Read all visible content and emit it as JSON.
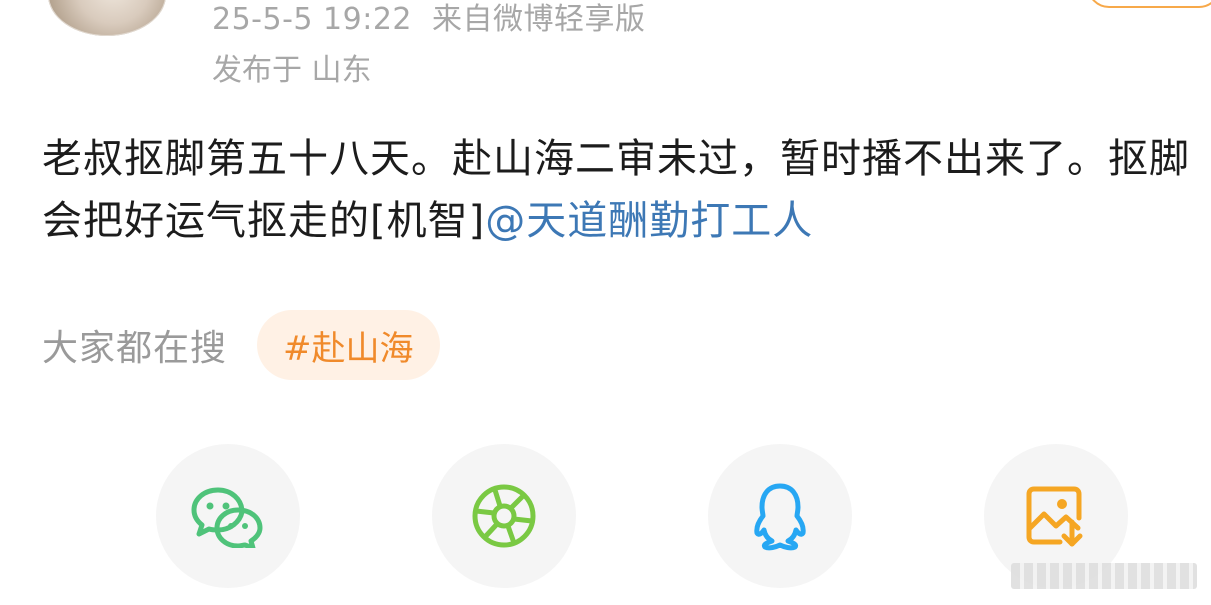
{
  "post": {
    "timestamp": "25-5-5 19:22",
    "source": "来自微博轻享版",
    "location": "发布于 山东",
    "text": "老叔抠脚第五十八天。赴山海二审未过，暂时播不出来了。抠脚会把好运气抠走的[机智]",
    "mention": "@天道酬勤打工人"
  },
  "search": {
    "label": "大家都在搜",
    "topic": "#赴山海"
  },
  "share": {
    "icons": [
      "wechat-icon",
      "moments-icon",
      "qq-icon",
      "save-image-icon"
    ]
  },
  "colors": {
    "text": "#1c1c1c",
    "meta": "#a7a7a7",
    "mention": "#3d78b5",
    "topic_text": "#f08a2b",
    "topic_bg": "#fff1e5",
    "wechat": "#4fc37a",
    "moments": "#7ac943",
    "qq": "#27a7f3",
    "save": "#f5a623"
  }
}
